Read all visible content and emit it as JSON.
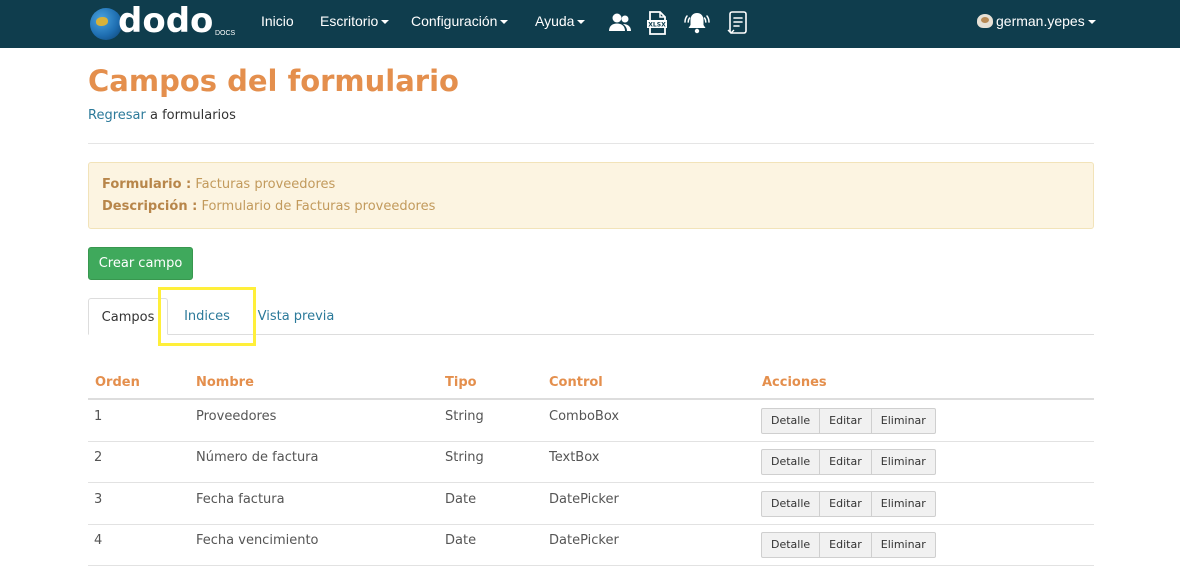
{
  "nav": {
    "brand": "dodo",
    "brand_sub": "DOCS",
    "items": [
      {
        "label": "Inicio",
        "dropdown": false
      },
      {
        "label": "Escritorio",
        "dropdown": true
      },
      {
        "label": "Configuración",
        "dropdown": true
      },
      {
        "label": "Ayuda",
        "dropdown": true
      }
    ],
    "icons": [
      "users-icon",
      "xlsx-file-icon",
      "bell-icon",
      "document-icon"
    ],
    "user": "german.yepes"
  },
  "page": {
    "title": "Campos del formulario",
    "back_link": "Regresar",
    "back_suffix": " a formularios"
  },
  "info": {
    "formulario_label": "Formulario :",
    "formulario_value": "Facturas proveedores",
    "descripcion_label": "Descripción :",
    "descripcion_value": "Formulario de Facturas proveedores"
  },
  "actions": {
    "create": "Crear campo"
  },
  "tabs": [
    {
      "label": "Campos",
      "active": true
    },
    {
      "label": "Indices",
      "active": false,
      "highlighted": true
    },
    {
      "label": "Vista previa",
      "active": false
    }
  ],
  "table": {
    "headers": [
      "Orden",
      "Nombre",
      "Tipo",
      "Control",
      "Acciones"
    ],
    "rows": [
      {
        "orden": "1",
        "nombre": "Proveedores",
        "tipo": "String",
        "control": "ComboBox"
      },
      {
        "orden": "2",
        "nombre": "Número de factura",
        "tipo": "String",
        "control": "TextBox"
      },
      {
        "orden": "3",
        "nombre": "Fecha factura",
        "tipo": "Date",
        "control": "DatePicker"
      },
      {
        "orden": "4",
        "nombre": "Fecha vencimiento",
        "tipo": "Date",
        "control": "DatePicker"
      }
    ],
    "row_actions": [
      "Detalle",
      "Editar",
      "Eliminar"
    ]
  },
  "colors": {
    "navbar": "#0f3d4d",
    "accent": "#e48f4d",
    "link": "#2c7a9a",
    "success": "#3fa95c",
    "highlight": "#ffef3a"
  }
}
